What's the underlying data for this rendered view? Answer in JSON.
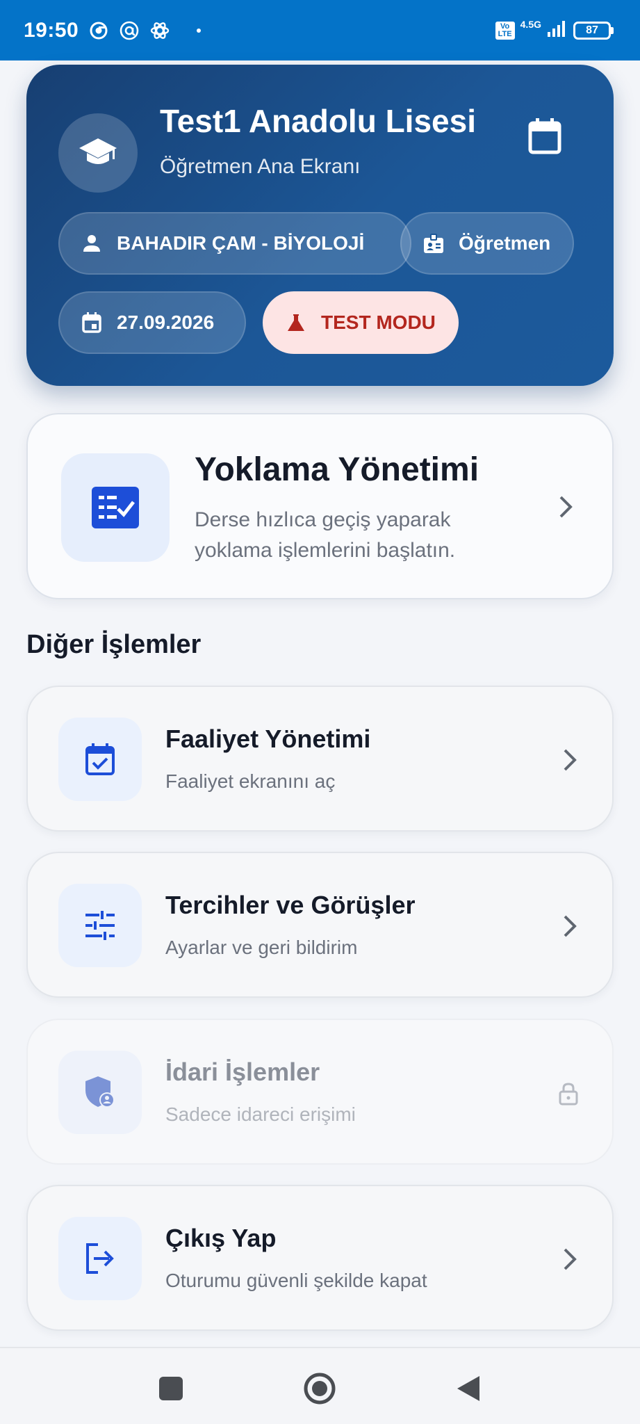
{
  "status_bar": {
    "time": "19:50",
    "network_badge": "Vo LTE",
    "network_type": "4.5G",
    "battery": "87"
  },
  "header": {
    "school_name": "Test1 Anadolu Lisesi",
    "subtitle": "Öğretmen Ana Ekranı",
    "user_chip": "BAHADIR ÇAM - BİYOLOJİ",
    "role_chip": "Öğretmen",
    "date_chip": "27.09.2026",
    "test_mode_chip": "TEST MODU"
  },
  "attendance": {
    "title": "Yoklama Yönetimi",
    "description": "Derse hızlıca geçiş yaparak yoklama işlemlerini başlatın."
  },
  "section_title": "Diğer İşlemler",
  "menu": [
    {
      "title": "Faaliyet Yönetimi",
      "subtitle": "Faaliyet ekranını aç",
      "icon": "calendar-check-icon",
      "enabled": true
    },
    {
      "title": "Tercihler ve Görüşler",
      "subtitle": "Ayarlar ve geri bildirim",
      "icon": "sliders-icon",
      "enabled": true
    },
    {
      "title": "İdari İşlemler",
      "subtitle": "Sadece idareci erişimi",
      "icon": "admin-shield-icon",
      "enabled": false
    },
    {
      "title": "Çıkış Yap",
      "subtitle": "Oturumu güvenli şekilde kapat",
      "icon": "logout-icon",
      "enabled": true
    }
  ],
  "colors": {
    "status_bar": "#0473c8",
    "header_gradient_start": "#173f72",
    "header_gradient_end": "#1c5a9c",
    "accent_blue": "#1d4ed8",
    "test_mode_bg": "#fde4e4",
    "test_mode_text": "#b3261e"
  }
}
